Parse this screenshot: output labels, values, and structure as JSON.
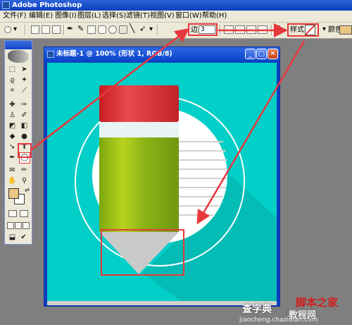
{
  "app": {
    "title": "Adobe Photoshop"
  },
  "menu": {
    "items": [
      "文件(F)",
      "编辑(E)",
      "图像(I)",
      "图层(L)",
      "选择(S)",
      "滤镜(T)",
      "视图(V)",
      "窗口(W)",
      "帮助(H)"
    ]
  },
  "options": {
    "radius_label": "边:",
    "radius_value": "3",
    "style_label": "样式:",
    "color_label": "颜色:",
    "color_value": "#e9c682"
  },
  "toolbox": {
    "selected_tool": "ellipse-tool",
    "fg_color": "#e9c682",
    "bg_color": "#ffffff"
  },
  "document": {
    "title": "未标题-1 @ 100% (形状 1, RGB/8)",
    "canvas_bg": "#02cfc8"
  },
  "watermark": {
    "line1": "查字典",
    "line2": "教程网",
    "brand_text": "脚本之家",
    "url": "jiaocheng.chazidian.com"
  },
  "colors": {
    "highlight_red": "#e8383c",
    "pencil_top": "#d9262c",
    "pencil_band": "#e8f4f4",
    "pencil_body": "#8fb51a",
    "pencil_tip": "#c8c9c9",
    "circle_fill": "#ffffff"
  }
}
